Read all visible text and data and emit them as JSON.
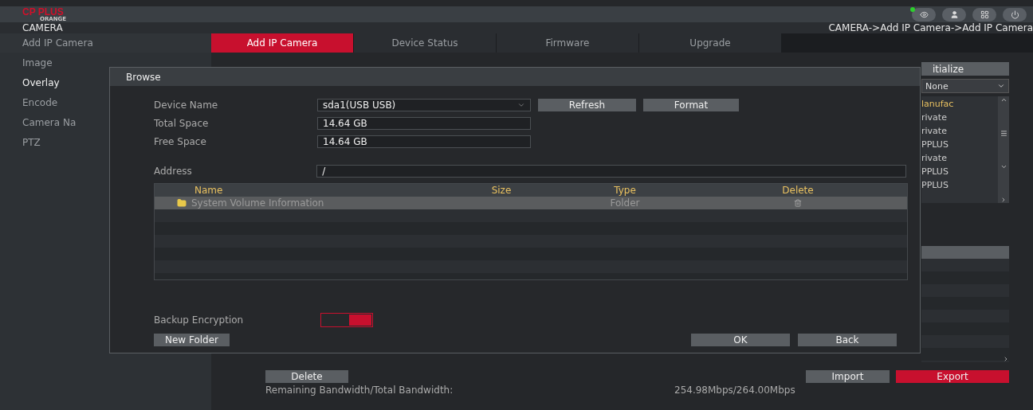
{
  "header": {
    "logo": "CP PLUS",
    "logo_sub": "ORANGE",
    "section": "CAMERA",
    "breadcrumb": "CAMERA->Add IP Camera->Add IP Camera"
  },
  "sidebar": {
    "heading": "Add IP Camera",
    "items": [
      {
        "label": "Image",
        "selected": false
      },
      {
        "label": "Overlay",
        "selected": true
      },
      {
        "label": "Encode",
        "selected": false
      },
      {
        "label": "Camera Na",
        "selected": false
      },
      {
        "label": "PTZ",
        "selected": false
      }
    ]
  },
  "tabs": [
    {
      "label": "Add IP Camera",
      "selected": true
    },
    {
      "label": "Device Status",
      "selected": false
    },
    {
      "label": "Firmware",
      "selected": false
    },
    {
      "label": "Upgrade",
      "selected": false
    }
  ],
  "background": {
    "initialize_button": "itialize",
    "filter": "None",
    "list_header": "lanufac",
    "list_rows": [
      "rivate",
      "rivate",
      "PPLUS",
      "rivate",
      "PPLUS",
      "PPLUS"
    ],
    "delete_button": "Delete",
    "bandwidth_label": "Remaining Bandwidth/Total Bandwidth:",
    "bandwidth_value": "254.98Mbps/264.00Mbps",
    "import_button": "Import",
    "export_button": "Export"
  },
  "dialog": {
    "title": "Browse",
    "device_name": {
      "label": "Device Name",
      "value": "sda1(USB USB)"
    },
    "refresh_button": "Refresh",
    "format_button": "Format",
    "total_space": {
      "label": "Total Space",
      "value": "14.64 GB"
    },
    "free_space": {
      "label": "Free Space",
      "value": "14.64 GB"
    },
    "address": {
      "label": "Address",
      "value": "/"
    },
    "table": {
      "columns": [
        "Name",
        "Size",
        "Type",
        "Delete"
      ],
      "rows": [
        {
          "name": "System Volume Information",
          "type": "Folder",
          "selected": true
        }
      ]
    },
    "backup_encryption": {
      "label": "Backup Encryption",
      "on": true
    },
    "new_folder_button": "New Folder",
    "ok_button": "OK",
    "back_button": "Back"
  }
}
